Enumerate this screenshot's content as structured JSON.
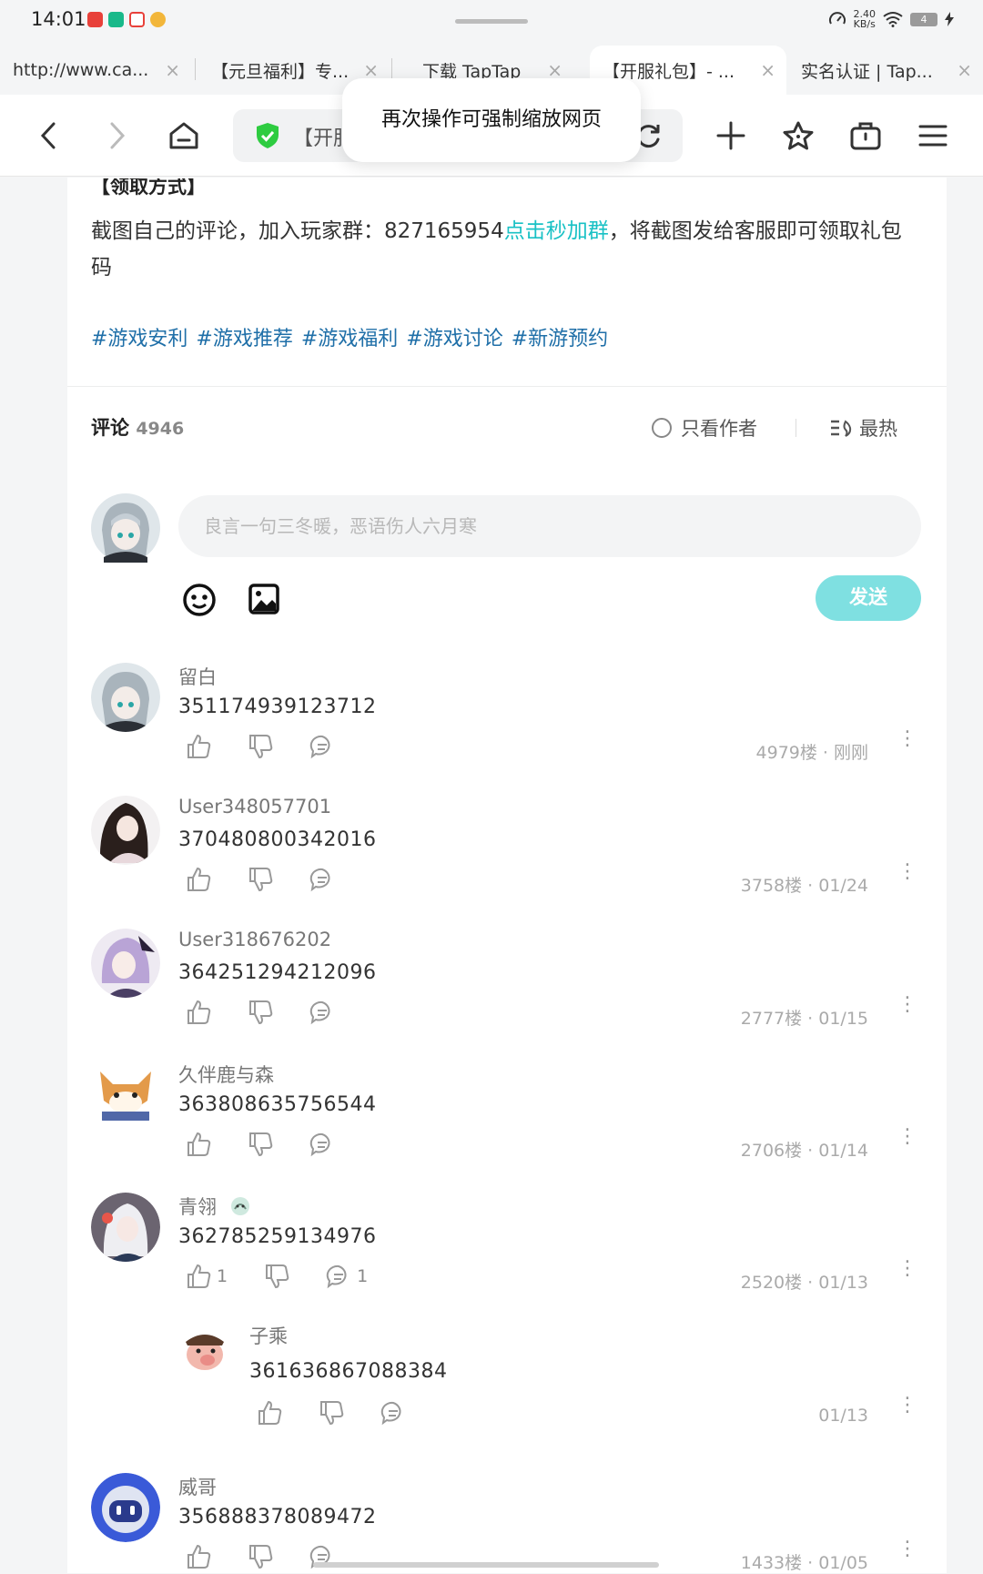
{
  "status_bar": {
    "time": "14:01",
    "speed_value": "2.40",
    "speed_unit": "KB/s",
    "battery": "4"
  },
  "tabs": [
    {
      "label": "http://www.ca...",
      "active": false
    },
    {
      "label": "【元旦福利】专...",
      "active": false
    },
    {
      "label": "下载 TapTap",
      "active": false
    },
    {
      "label": "【开服礼包】- ...",
      "active": true
    },
    {
      "label": "实名认证 | Tap...",
      "active": false
    }
  ],
  "toolbar": {
    "url_text": "【开服"
  },
  "toast": "再次操作可强制缩放网页",
  "post": {
    "heading": "【领取方式】",
    "body_prefix": "截图自己的评论，加入玩家群：827165954",
    "body_link": "点击秒加群",
    "body_suffix": "，将截图发给客服即可领取礼包码",
    "tags": "#游戏安利 #游戏推荐 #游戏福利 #游戏讨论 #新游预约"
  },
  "comments_header": {
    "title": "评论",
    "count": "4946",
    "author_only": "只看作者",
    "sort": "最热"
  },
  "composer": {
    "placeholder": "良言一句三冬暖，恶语伤人六月寒",
    "send": "发送"
  },
  "comments": [
    {
      "name": "留白",
      "text": "351174939123712",
      "meta": "4979楼 · 刚刚",
      "likes": "",
      "replies": ""
    },
    {
      "name": "User348057701",
      "text": "370480800342016",
      "meta": "3758楼 · 01/24",
      "likes": "",
      "replies": ""
    },
    {
      "name": "User318676202",
      "text": "364251294212096",
      "meta": "2777楼 · 01/15",
      "likes": "",
      "replies": ""
    },
    {
      "name": "久伴鹿与森",
      "text": "363808635756544",
      "meta": "2706楼 · 01/14",
      "likes": "",
      "replies": ""
    },
    {
      "name": "青翎",
      "text": "362785259134976",
      "meta": "2520楼 · 01/13",
      "likes": "1",
      "replies": "1"
    },
    {
      "name": "子乘",
      "text": "361636867088384",
      "meta": "01/13",
      "likes": "",
      "replies": ""
    },
    {
      "name": "威哥",
      "text": "356888378089472",
      "meta": "1433楼 · 01/05",
      "likes": "",
      "replies": ""
    }
  ],
  "colors": {
    "accent": "#19c1c5",
    "tag": "#1f6fa8",
    "send_bg": "#7fe0e1",
    "shield": "#2ecc40"
  }
}
